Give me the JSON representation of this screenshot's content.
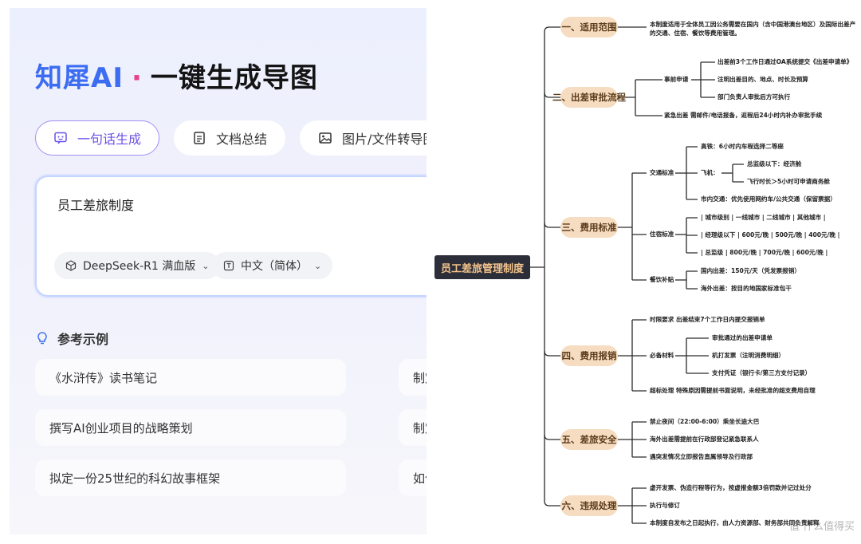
{
  "left": {
    "brand": "知犀AI",
    "dot": "·",
    "slogan": "一键生成导图",
    "tabs": [
      {
        "label": "一句话生成",
        "icon": "chat-sparkle-icon"
      },
      {
        "label": "文档总结",
        "icon": "document-icon"
      },
      {
        "label": "图片/文件转导图",
        "icon": "image-icon"
      }
    ],
    "input": {
      "value": "员工差旅制度"
    },
    "model": {
      "label": "DeepSeek-R1 满血版",
      "icon": "cube-icon"
    },
    "language": {
      "label": "中文（简体）",
      "icon": "translate-icon"
    },
    "examples_title": "参考示例",
    "examples_icon": "lightbulb-icon",
    "examples": [
      "《水浒传》读书笔记",
      "撰写AI创业项目的战略策划",
      "拟定一份25世纪的科幻故事框架",
      "制定",
      "制定",
      "如何"
    ]
  },
  "mindmap": {
    "root": "员工差旅管理制度",
    "sections": [
      {
        "label": "一、适用范围",
        "items": [
          "本制度适用于全体员工因公务需要在国内（含中国港澳台地区）及国际出差产",
          "的交通、住宿、餐饮等费用管理。"
        ]
      },
      {
        "label": "二、出差审批流程",
        "sub": "事前申请",
        "subitems": [
          "出差前3个工作日通过OA系统提交《出差申请单》",
          "注明出差目的、地点、时长及预算",
          "部门负责人审批后方可执行"
        ],
        "items": [
          "紧急出差 需邮件/电话报备，返程后24小时内补办审批手续"
        ]
      },
      {
        "label": "三、费用标准",
        "traffic": "交通标准",
        "traffic_items": [
          "高铁：6小时内车程选择二等座",
          "飞机：",
          "市内交通：优先使用网约车/公共交通（保留票据）"
        ],
        "flight_items": [
          "总监级以下：经济舱",
          "飞行时长＞5小时可申请商务舱"
        ],
        "hotel": "住宿标准",
        "hotel_items": [
          "| 城市级别 | 一线城市 | 二线城市 | 其他城市 |",
          "| 经理级以下 | 600元/晚 | 500元/晚 | 400元/晚 |",
          "| 总监级 | 800元/晚 | 700元/晚 | 600元/晚 |"
        ],
        "meal": "餐饮补贴",
        "meal_items": [
          "国内出差：150元/天（凭发票报销）",
          "海外出差：按目的地国家标准包干"
        ]
      },
      {
        "label": "四、费用报销",
        "items_top": [
          "时限要求 出差结束7个工作日内提交报销单"
        ],
        "sub": "必备材料",
        "subitems": [
          "审批通过的出差申请单",
          "机打发票（注明消费明细）",
          "支付凭证（银行卡/第三方支付记录）"
        ],
        "items_bottom": [
          "超标处理 特殊原因需提前书面说明，未经批准的超支费用自理"
        ]
      },
      {
        "label": "五、差旅安全",
        "items": [
          "禁止夜间（22:00-6:00）乘坐长途大巴",
          "海外出差需提前在行政部登记紧急联系人",
          "遇突发情况立即报告直属领导及行政部"
        ]
      },
      {
        "label": "六、违规处理",
        "items": [
          "虚开发票、伪造行程等行为，按虚报金额3倍罚款并记过处分",
          "执行与修订",
          "本制度自发布之日起执行，由人力资源部、财务部共同负责解释"
        ]
      }
    ],
    "watermark": "值 什么值得买"
  }
}
